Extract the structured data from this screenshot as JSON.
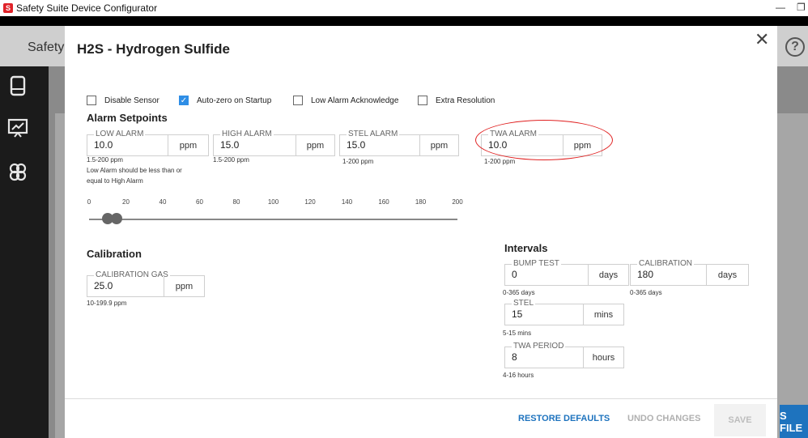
{
  "window": {
    "title": "Safety Suite Device Configurator",
    "minimize_glyph": "—",
    "restore_glyph": "❐"
  },
  "background": {
    "page_title": "Safety",
    "help_glyph": "?",
    "files_label": "S FILE",
    "sidebar_icons": [
      "device-icon",
      "chart-icon",
      "users-icon"
    ]
  },
  "dialog": {
    "title": "H2S - Hydrogen Sulfide",
    "close_glyph": "✕",
    "checkboxes": [
      {
        "label": "Disable Sensor",
        "checked": false
      },
      {
        "label": "Auto-zero on Startup",
        "checked": true
      },
      {
        "label": "Low Alarm Acknowledge",
        "checked": false
      },
      {
        "label": "Extra Resolution",
        "checked": false
      }
    ],
    "alarm_section": "Alarm Setpoints",
    "alarms": {
      "low": {
        "label": "LOW ALARM",
        "value": "10.0",
        "unit": "ppm",
        "range": "1.5-200 ppm",
        "note_1": "Low Alarm should be less than or",
        "note_2": "equal to High Alarm"
      },
      "high": {
        "label": "HIGH ALARM",
        "value": "15.0",
        "unit": "ppm",
        "range": "1.5-200 ppm"
      },
      "stel": {
        "label": "STEL ALARM",
        "value": "15.0",
        "unit": "ppm",
        "range": "1-200 ppm"
      },
      "twa": {
        "label": "TWA ALARM",
        "value": "10.0",
        "unit": "ppm",
        "range": "1-200 ppm"
      }
    },
    "slider": {
      "scale": [
        "0",
        "20",
        "40",
        "60",
        "80",
        "100",
        "120",
        "140",
        "160",
        "180",
        "200"
      ],
      "min": 0,
      "max": 200,
      "low_value": 10.0,
      "high_value": 15.0
    },
    "calibration_section": "Calibration",
    "calibration_gas": {
      "label": "CALIBRATION GAS",
      "value": "25.0",
      "unit": "ppm",
      "range": "10-199.9 ppm"
    },
    "intervals_section": "Intervals",
    "intervals": {
      "bump": {
        "label": "BUMP TEST",
        "value": "0",
        "unit": "days",
        "range": "0-365 days"
      },
      "calibration": {
        "label": "CALIBRATION",
        "value": "180",
        "unit": "days",
        "range": "0-365 days"
      },
      "stel": {
        "label": "STEL",
        "value": "15",
        "unit": "mins",
        "range": "5-15 mins"
      },
      "twa": {
        "label": "TWA PERIOD",
        "value": "8",
        "unit": "hours",
        "range": "4-16 hours"
      }
    },
    "buttons": {
      "restore": "RESTORE DEFAULTS",
      "undo": "UNDO CHANGES",
      "save": "SAVE"
    },
    "accent_color": "#1e73be",
    "checkbox_color": "#2e8ee6",
    "annotation_color": "#e02020"
  }
}
